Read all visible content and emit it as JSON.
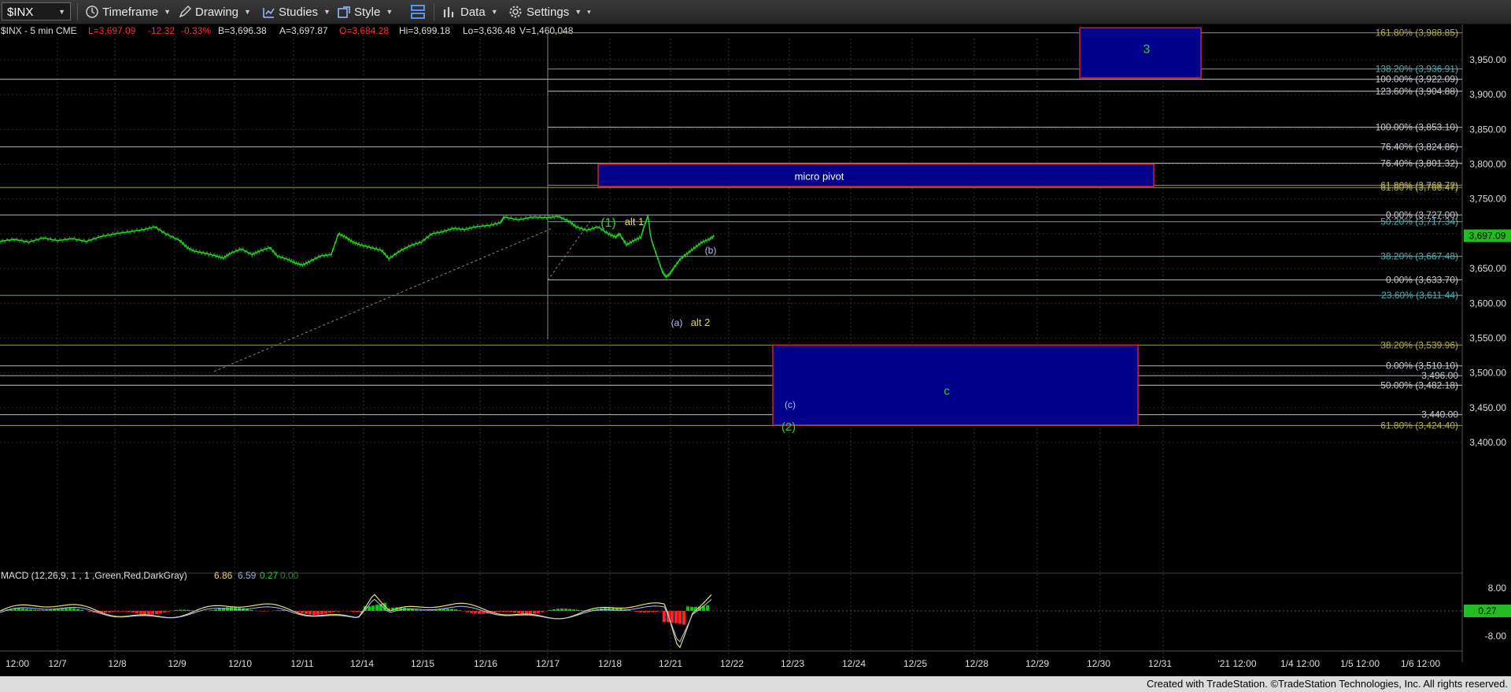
{
  "toolbar": {
    "symbol": "$INX",
    "timeframe_label": "Timeframe",
    "drawing_label": "Drawing",
    "studies_label": "Studies",
    "style_label": "Style",
    "data_label": "Data",
    "settings_label": "Settings"
  },
  "quote": {
    "symbol_text": "$INX - 5 min  CME",
    "last": "L=3,697.09",
    "change": "-12.32",
    "change_pct": "-0.33%",
    "bid": "B=3,696.38",
    "ask": "A=3,697.87",
    "open": "O=3,684.28",
    "high": "Hi=3,699.18",
    "low": "Lo=3,636.48",
    "volume": "V=1,460,048"
  },
  "colors": {
    "price": "#22dd22",
    "up": "#00cc00",
    "down": "#ff2222",
    "box_fill": "#00008b",
    "box_border": "#cc2233",
    "fib_gray": "#9aa0a8",
    "fib_teal": "#3a9a9a",
    "fib_olive": "#8a8a3a",
    "label_yellow": "#e8d84a",
    "label_green": "#33cc33",
    "label_blue": "#b0c0ff"
  },
  "chart_data": {
    "type": "line",
    "series_note": "S&P 500 5-min price",
    "y_axis_ticks": [
      "3,950.00",
      "3,900.00",
      "3,850.00",
      "3,800.00",
      "3,750.00",
      "3,700.00",
      "3,650.00",
      "3,600.00",
      "3,550.00",
      "3,500.00",
      "3,450.00",
      "3,400.00"
    ],
    "ylim": [
      3390,
      3995
    ],
    "x_axis_ticks": [
      "12:00",
      "12/7",
      "12/8",
      "12/9",
      "12/10",
      "12/11",
      "12/14",
      "12/15",
      "12/16",
      "12/17",
      "12/18",
      "12/21",
      "12/22",
      "12/23",
      "12/24",
      "12/25",
      "12/28",
      "12/29",
      "12/30",
      "12/31",
      "'21 12:00",
      "1/4 12:00",
      "1/5 12:00",
      "1/6 12:00"
    ],
    "last_price_badge": "3,697.09",
    "price_path": [
      [
        0,
        3689
      ],
      [
        20,
        3692
      ],
      [
        40,
        3688
      ],
      [
        60,
        3694
      ],
      [
        80,
        3690
      ],
      [
        100,
        3693
      ],
      [
        120,
        3689
      ],
      [
        140,
        3696
      ],
      [
        160,
        3700
      ],
      [
        180,
        3703
      ],
      [
        200,
        3706
      ],
      [
        215,
        3710
      ],
      [
        230,
        3700
      ],
      [
        250,
        3690
      ],
      [
        260,
        3680
      ],
      [
        270,
        3675
      ],
      [
        285,
        3672
      ],
      [
        300,
        3668
      ],
      [
        310,
        3665
      ],
      [
        320,
        3672
      ],
      [
        335,
        3678
      ],
      [
        350,
        3670
      ],
      [
        360,
        3675
      ],
      [
        375,
        3680
      ],
      [
        385,
        3668
      ],
      [
        400,
        3663
      ],
      [
        410,
        3658
      ],
      [
        420,
        3655
      ],
      [
        430,
        3660
      ],
      [
        445,
        3668
      ],
      [
        460,
        3670
      ],
      [
        470,
        3700
      ],
      [
        480,
        3695
      ],
      [
        490,
        3688
      ],
      [
        500,
        3684
      ],
      [
        515,
        3680
      ],
      [
        530,
        3676
      ],
      [
        540,
        3664
      ],
      [
        555,
        3675
      ],
      [
        570,
        3683
      ],
      [
        585,
        3688
      ],
      [
        600,
        3700
      ],
      [
        615,
        3703
      ],
      [
        630,
        3708
      ],
      [
        645,
        3706
      ],
      [
        660,
        3710
      ],
      [
        680,
        3712
      ],
      [
        695,
        3716
      ],
      [
        700,
        3724
      ],
      [
        720,
        3720
      ],
      [
        740,
        3724
      ],
      [
        760,
        3723
      ],
      [
        775,
        3725
      ],
      [
        790,
        3718
      ],
      [
        800,
        3710
      ],
      [
        815,
        3705
      ],
      [
        830,
        3710
      ],
      [
        845,
        3700
      ],
      [
        855,
        3695
      ],
      [
        860,
        3700
      ],
      [
        870,
        3684
      ],
      [
        880,
        3690
      ],
      [
        890,
        3695
      ],
      [
        895,
        3712
      ],
      [
        900,
        3726
      ],
      [
        903,
        3700
      ],
      [
        905,
        3690
      ],
      [
        910,
        3675
      ],
      [
        915,
        3660
      ],
      [
        920,
        3645
      ],
      [
        925,
        3638
      ],
      [
        930,
        3642
      ],
      [
        935,
        3650
      ],
      [
        945,
        3664
      ],
      [
        955,
        3672
      ],
      [
        965,
        3680
      ],
      [
        975,
        3688
      ],
      [
        985,
        3692
      ],
      [
        992,
        3697
      ]
    ],
    "fib_levels": [
      {
        "label": "161.80% (3,988.85)",
        "value": 3988.85,
        "color": "olive"
      },
      {
        "label": "138.20% (3,936.91)",
        "value": 3936.91,
        "color": "teal"
      },
      {
        "label": "100.00% (3,922.09)",
        "value": 3922.09,
        "color": "gray"
      },
      {
        "label": "123.60% (3,904.88)",
        "value": 3904.88,
        "color": "gray"
      },
      {
        "label": "100.00% (3,853.10)",
        "value": 3853.1,
        "color": "gray"
      },
      {
        "label": "76.40% (3,824.86)",
        "value": 3824.86,
        "color": "gray"
      },
      {
        "label": "76.40% (3,801.32)",
        "value": 3801.32,
        "color": "gray"
      },
      {
        "label": "61.80% (3,769.72)",
        "value": 3769.72,
        "color": "olive"
      },
      {
        "label": "61.80% (3,766.47)",
        "value": 3766.47,
        "color": "olive"
      },
      {
        "label": "0.00% (3,727.00)",
        "value": 3727.0,
        "color": "gray"
      },
      {
        "label": "50.20% (3,717.34)",
        "value": 3717.34,
        "color": "teal"
      },
      {
        "label": "38.20% (3,667.48)",
        "value": 3667.48,
        "color": "teal"
      },
      {
        "label": "0.00% (3,633.70)",
        "value": 3633.7,
        "color": "gray"
      },
      {
        "label": "23.60% (3,611.44)",
        "value": 3611.44,
        "color": "teal"
      },
      {
        "label": "38.20% (3,539.96)",
        "value": 3539.96,
        "color": "olive"
      },
      {
        "label": "0.00% (3,510.10)",
        "value": 3510.1,
        "color": "gray"
      },
      {
        "label": "3,496.00",
        "value": 3496.0,
        "color": "gray"
      },
      {
        "label": "50.00% (3,482.18)",
        "value": 3482.18,
        "color": "gray"
      },
      {
        "label": "3,440.00",
        "value": 3440.0,
        "color": "gray"
      },
      {
        "label": "61.80% (3,424.40)",
        "value": 3424.4,
        "color": "olive"
      }
    ],
    "boxes": [
      {
        "label": "3",
        "y_top": 3996,
        "y_bottom": 3924,
        "label_color": "green"
      },
      {
        "label": "micro pivot",
        "y_top": 3800,
        "y_bottom": 3768,
        "label_color": "white"
      },
      {
        "label": "c",
        "y_top": 3540,
        "y_bottom": 3425,
        "label_color": "green"
      }
    ],
    "wave_labels": [
      {
        "text": "(1)",
        "color": "green"
      },
      {
        "text": "alt 1",
        "color": "yellow"
      },
      {
        "text": "(b)",
        "color": "blue"
      },
      {
        "text": "(a)",
        "color": "blue"
      },
      {
        "text": "alt 2",
        "color": "yellow"
      },
      {
        "text": "(c)",
        "color": "blue"
      },
      {
        "text": "(2)",
        "color": "green"
      }
    ],
    "macd": {
      "title": "MACD (12,26,9, 1 , 1 ,Green,Red,DarkGray)",
      "macd_value": "6.86",
      "signal_value": "6.59",
      "hist_value": "0.27",
      "zero_value": "0.00",
      "axis_ticks": [
        "8.00",
        "-8.00"
      ],
      "badge": "0.27"
    }
  },
  "footer": {
    "text": "Created with TradeStation. ©TradeStation Technologies, Inc. All rights reserved."
  }
}
